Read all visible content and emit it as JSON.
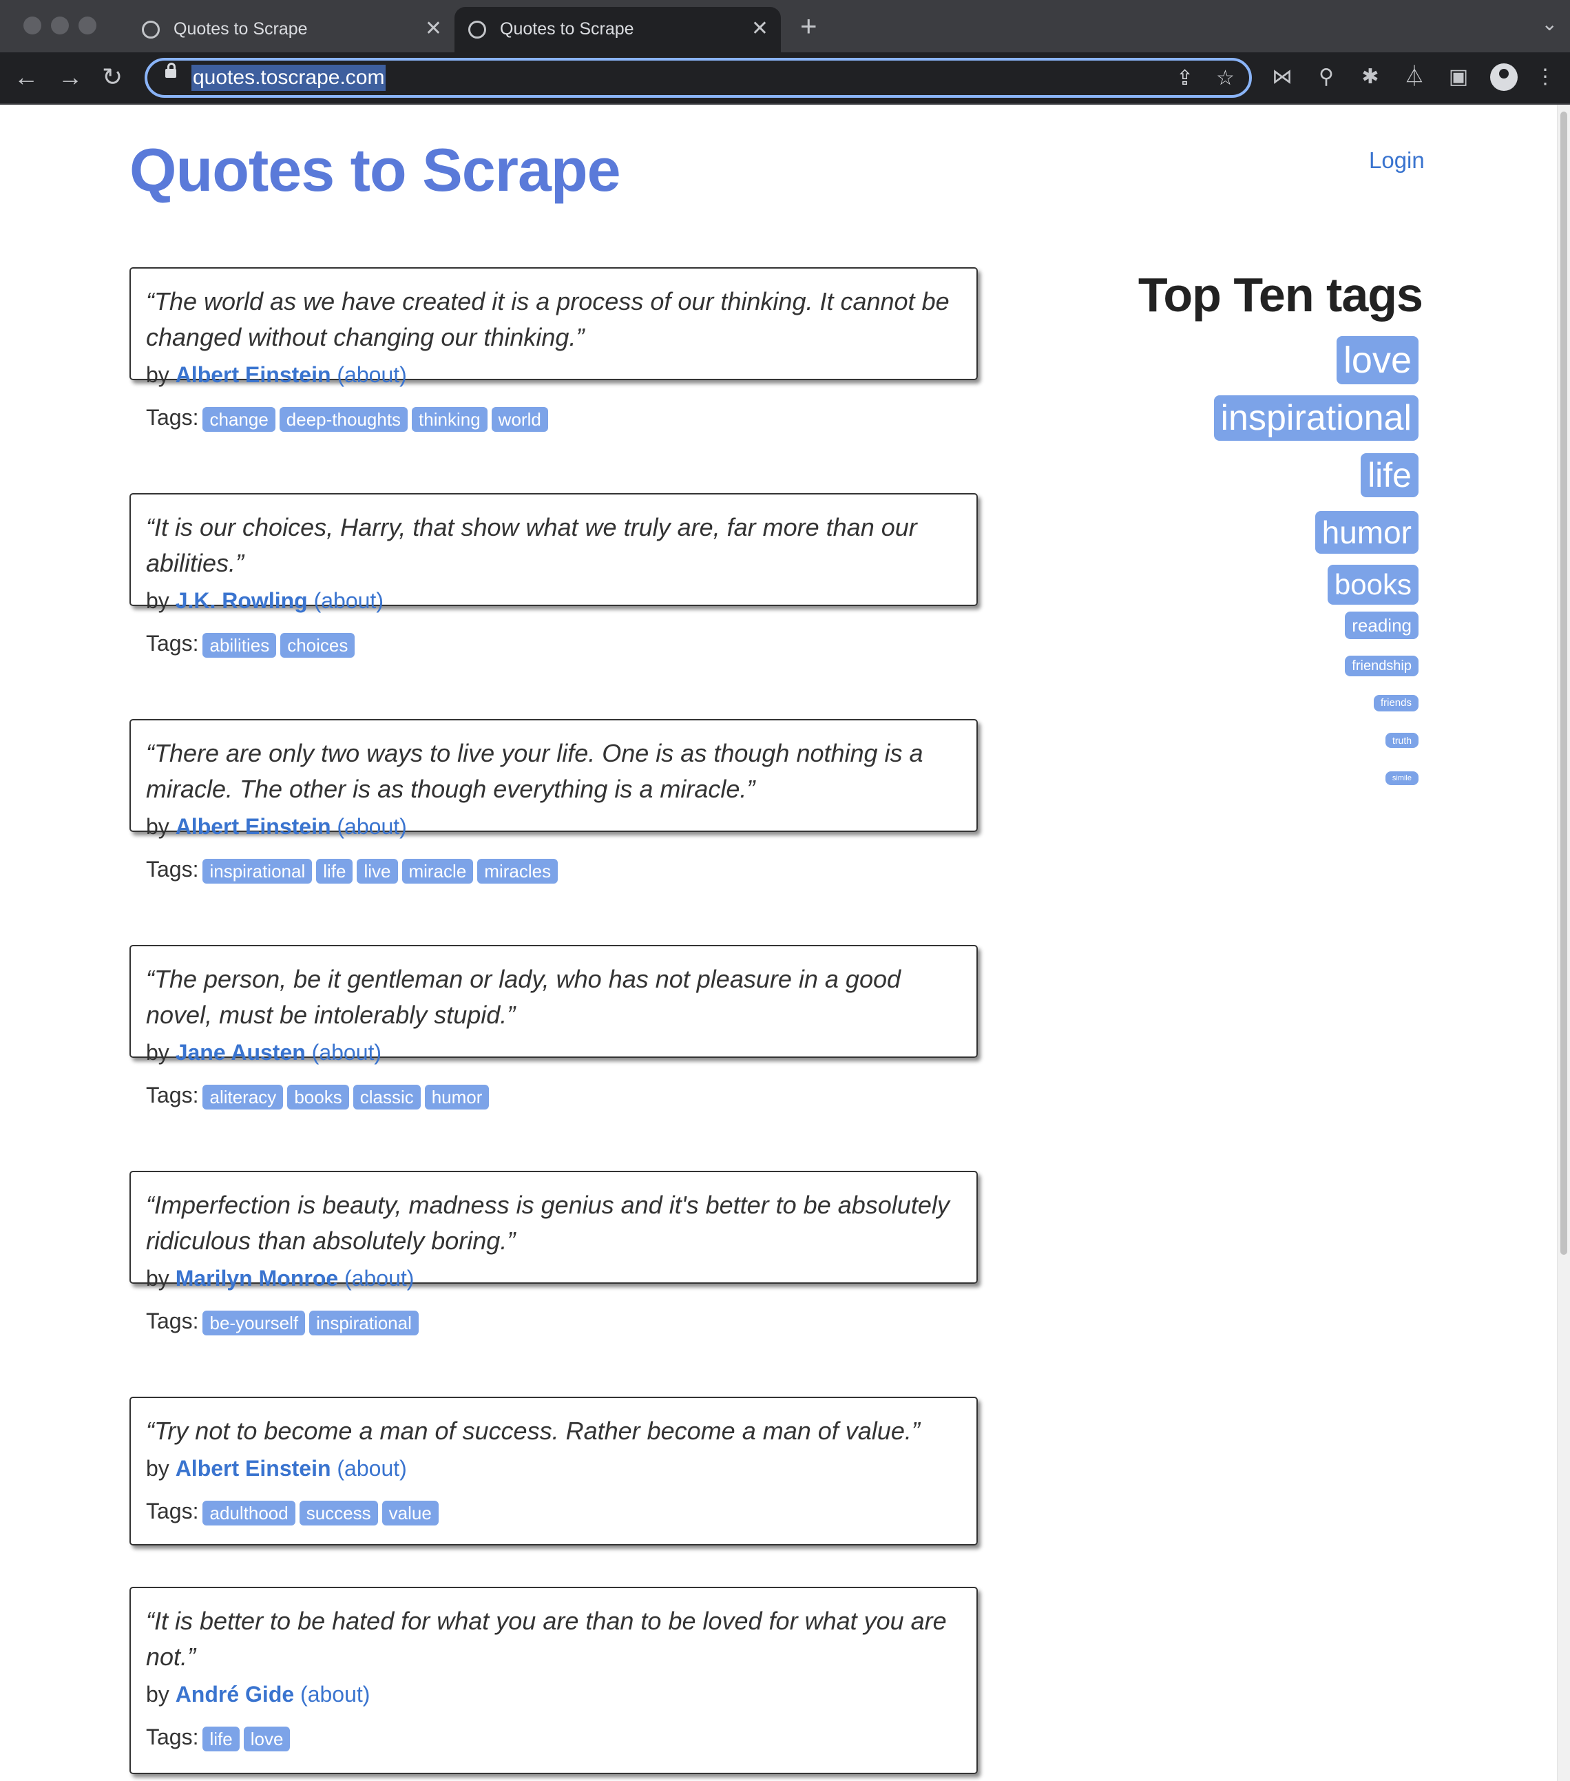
{
  "browser": {
    "tabs": [
      {
        "title": "Quotes to Scrape",
        "active": false
      },
      {
        "title": "Quotes to Scrape",
        "active": true
      }
    ],
    "address_bar": {
      "url": "quotes.toscrape.com"
    },
    "icons": [
      "back-icon",
      "forward-icon",
      "reload-icon",
      "lock-icon",
      "share-icon",
      "star-icon",
      "extension-icon",
      "puzzle-icon",
      "lab-icon",
      "sidepanel-icon",
      "profile-icon",
      "menu-icon"
    ]
  },
  "header": {
    "title": "Quotes to Scrape",
    "login": "Login"
  },
  "quotes": [
    {
      "text": "“The world as we have created it is a process of our thinking. It cannot be changed without changing our thinking.”",
      "by": "by",
      "author": "Albert Einstein",
      "about": "(about)",
      "tags_label": "Tags:",
      "tags": [
        "change",
        "deep-thoughts",
        "thinking",
        "world"
      ]
    },
    {
      "text": "“It is our choices, Harry, that show what we truly are, far more than our abilities.”",
      "by": "by",
      "author": "J.K. Rowling",
      "about": "(about)",
      "tags_label": "Tags:",
      "tags": [
        "abilities",
        "choices"
      ]
    },
    {
      "text": "“There are only two ways to live your life. One is as though nothing is a miracle. The other is as though everything is a miracle.”",
      "by": "by",
      "author": "Albert Einstein",
      "about": "(about)",
      "tags_label": "Tags:",
      "tags": [
        "inspirational",
        "life",
        "live",
        "miracle",
        "miracles"
      ]
    },
    {
      "text": "“The person, be it gentleman or lady, who has not pleasure in a good novel, must be intolerably stupid.”",
      "by": "by",
      "author": "Jane Austen",
      "about": "(about)",
      "tags_label": "Tags:",
      "tags": [
        "aliteracy",
        "books",
        "classic",
        "humor"
      ]
    },
    {
      "text": "“Imperfection is beauty, madness is genius and it's better to be absolutely ridiculous than absolutely boring.”",
      "by": "by",
      "author": "Marilyn Monroe",
      "about": "(about)",
      "tags_label": "Tags:",
      "tags": [
        "be-yourself",
        "inspirational"
      ]
    },
    {
      "text": "“Try not to become a man of success. Rather become a man of value.”",
      "by": "by",
      "author": "Albert Einstein",
      "about": "(about)",
      "tags_label": "Tags:",
      "tags": [
        "adulthood",
        "success",
        "value"
      ]
    },
    {
      "text": "“It is better to be hated for what you are than to be loved for what you are not.”",
      "by": "by",
      "author": "André Gide",
      "about": "(about)",
      "tags_label": "Tags:",
      "tags": [
        "life",
        "love"
      ]
    }
  ],
  "top_tags": {
    "heading": "Top Ten tags",
    "items": [
      "love",
      "inspirational",
      "life",
      "humor",
      "books",
      "reading",
      "friendship",
      "friends",
      "truth",
      "simile"
    ]
  },
  "colors": {
    "brand": "#5a7ad9",
    "link": "#3a74cf",
    "tag_bg": "#7ca3e8",
    "chrome_bg": "#202124",
    "focus_ring": "#8ab4f8"
  }
}
